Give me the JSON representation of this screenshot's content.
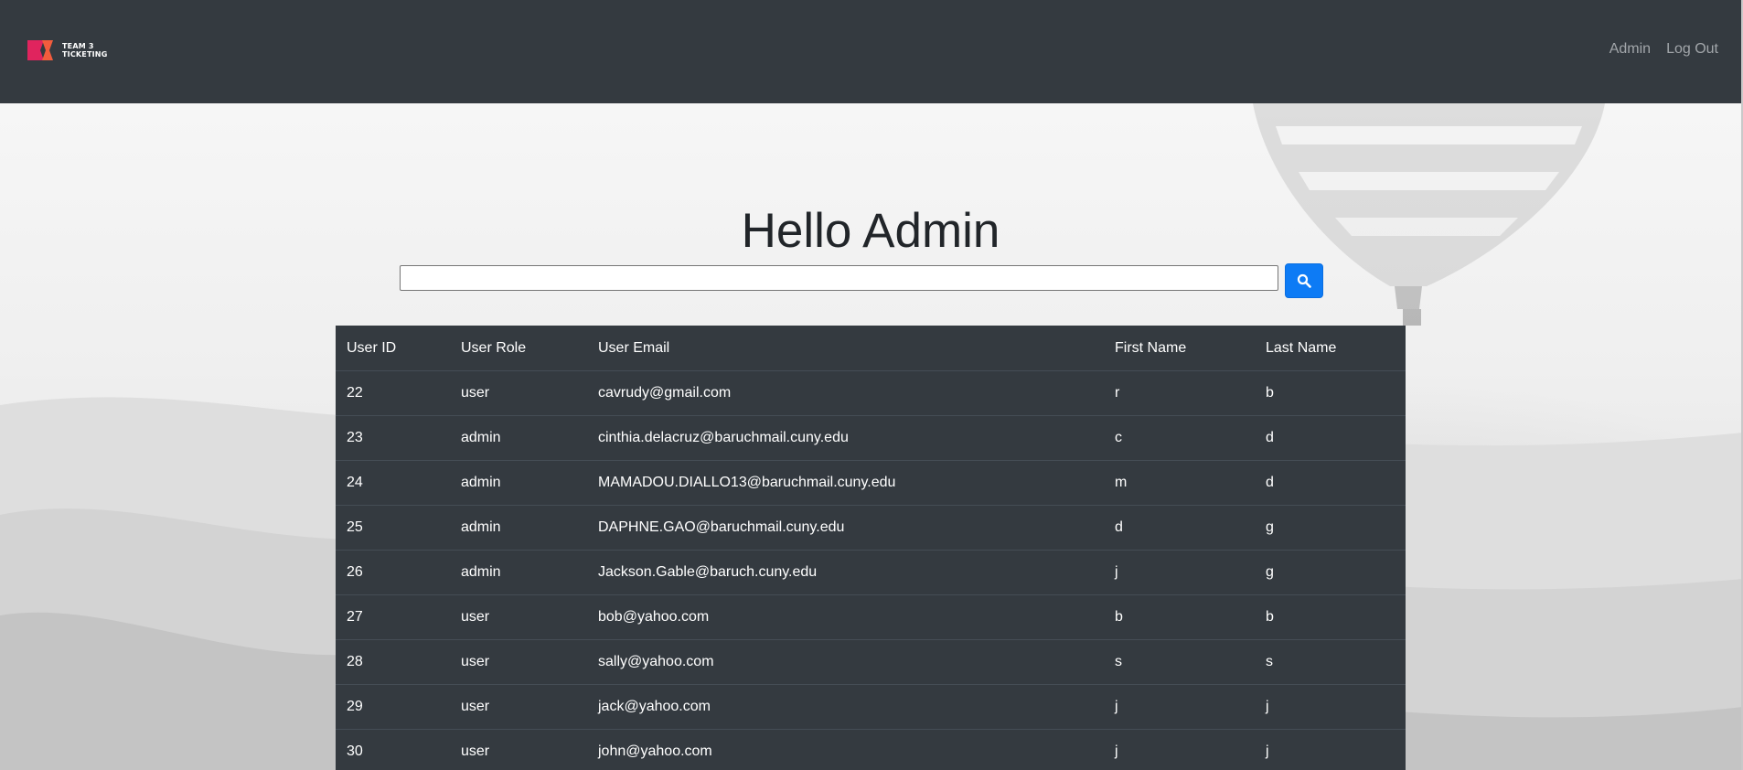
{
  "brand": {
    "logo_text": "TEAM 3 TICKETING",
    "line1": "TEAM 3",
    "line2": "TICKETING",
    "colors": {
      "logo_primary": "#e0245e",
      "logo_secondary": "#f25c3d"
    }
  },
  "nav": {
    "links": [
      {
        "label": "Admin"
      },
      {
        "label": "Log Out"
      }
    ]
  },
  "main": {
    "title": "Hello Admin",
    "search": {
      "value": "",
      "placeholder": "",
      "button_icon": "search-icon"
    }
  },
  "table": {
    "headers": [
      "User ID",
      "User Role",
      "User Email",
      "First Name",
      "Last Name"
    ],
    "rows": [
      [
        "22",
        "user",
        "cavrudy@gmail.com",
        "r",
        "b"
      ],
      [
        "23",
        "admin",
        "cinthia.delacruz@baruchmail.cuny.edu",
        "c",
        "d"
      ],
      [
        "24",
        "admin",
        "MAMADOU.DIALLO13@baruchmail.cuny.edu",
        "m",
        "d"
      ],
      [
        "25",
        "admin",
        "DAPHNE.GAO@baruchmail.cuny.edu",
        "d",
        "g"
      ],
      [
        "26",
        "admin",
        "Jackson.Gable@baruch.cuny.edu",
        "j",
        "g"
      ],
      [
        "27",
        "user",
        "bob@yahoo.com",
        "b",
        "b"
      ],
      [
        "28",
        "user",
        "sally@yahoo.com",
        "s",
        "s"
      ],
      [
        "29",
        "user",
        "jack@yahoo.com",
        "j",
        "j"
      ],
      [
        "30",
        "user",
        "john@yahoo.com",
        "j",
        "j"
      ]
    ]
  },
  "colors": {
    "navbar": "#343a40",
    "table_bg": "#343a40",
    "accent": "#0d7bf5",
    "nav_link": "#a2a6aa"
  }
}
